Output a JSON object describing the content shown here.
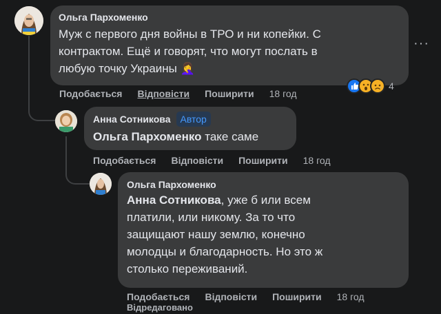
{
  "comments": [
    {
      "author": "Ольга Пархоменко",
      "text": "Муж с первого дня войны в ТРО и ни копейки. С контрактом. Ещё и говорят, что могут послать в любую точку Украины 🤦‍♀️",
      "text_lines": [
        "Муж с первого дня войны в ТРО и ни копейки. С",
        "контрактом. Ещё и говорят, что могут послать в",
        "любую точку Украины"
      ],
      "emoji": "🤦‍♀️",
      "actions": {
        "like": "Подобається",
        "reply": "Відповісти",
        "share": "Поширити",
        "time": "18 год"
      },
      "reactions": {
        "icons": [
          "like-icon",
          "wow-icon",
          "sad-icon"
        ],
        "count": "4"
      }
    },
    {
      "author": "Анна Сотникова",
      "badge": "Автор",
      "mention": "Ольга Пархоменко",
      "text_rest": "таке саме",
      "actions": {
        "like": "Подобається",
        "reply": "Відповісти",
        "share": "Поширити",
        "time": "18 год"
      }
    },
    {
      "author": "Ольга Пархоменко",
      "mention": "Анна Сотникова",
      "first_line_rest": ", уже б или всем",
      "text_lines": [
        "платили, или никому. За то что",
        "защищают нашу землю, конечно",
        "молодцы и благодарность. Но это ж",
        "столько переживаний."
      ],
      "actions": {
        "like": "Подобається",
        "reply": "Відповісти",
        "share": "Поширити",
        "time": "18 год",
        "edited": "Відредаговано"
      }
    }
  ],
  "more_options": "···",
  "colors": {
    "background": "#18191a",
    "bubble": "#3a3b3c",
    "text": "#e4e6eb",
    "secondary": "#b0b3b8",
    "badge_text": "#4599ff",
    "badge_bg": "#263951"
  }
}
